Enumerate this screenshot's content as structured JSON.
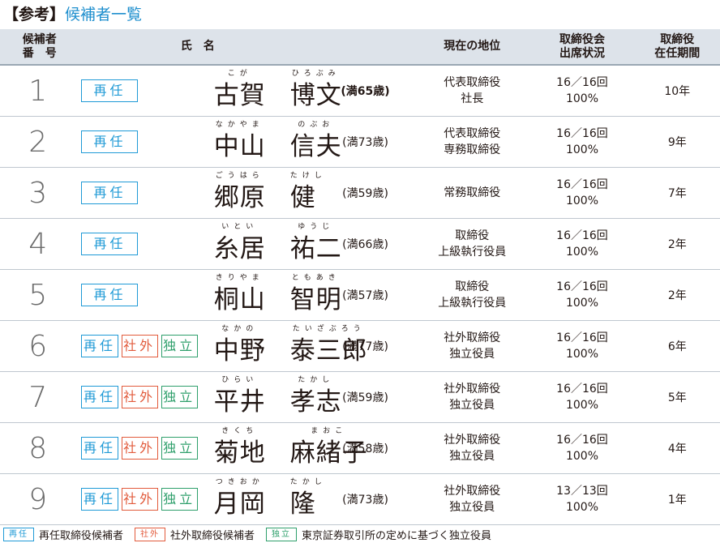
{
  "title": {
    "bracket": "【参考】",
    "text": "候補者一覧"
  },
  "headers": {
    "number": [
      "候補者",
      "番　号"
    ],
    "name": "氏　名",
    "position": "現在の地位",
    "attendance": [
      "取締役会",
      "出席状況"
    ],
    "term": [
      "取締役",
      "在任期間"
    ]
  },
  "badge_labels": {
    "re": "再任",
    "sha": "社外",
    "dok": "独立"
  },
  "colors": {
    "re": "#1f9ad6",
    "sha": "#e25b3c",
    "dok": "#2e9f6b",
    "title": "#1f8fce",
    "header_bg": "#dde3ea"
  },
  "candidates": [
    {
      "num": "1",
      "family": "古賀",
      "given": "博文",
      "family_ruby": "こが",
      "given_ruby": "ひろぶみ",
      "age": "(満65歳)",
      "pos1": "代表取締役",
      "pos2": "社長",
      "att1": "16／16回",
      "att2": "100%",
      "term": "10年",
      "outside": false
    },
    {
      "num": "2",
      "family": "中山",
      "given": "信夫",
      "family_ruby": "なかやま",
      "given_ruby": "のぶお",
      "age": "(満73歳)",
      "pos1": "代表取締役",
      "pos2": "専務取締役",
      "att1": "16／16回",
      "att2": "100%",
      "term": "9年",
      "outside": false
    },
    {
      "num": "3",
      "family": "郷原",
      "given": "健",
      "family_ruby": "ごうはら",
      "given_ruby": "たけし",
      "age": "(満59歳)",
      "pos1": "常務取締役",
      "pos2": "",
      "att1": "16／16回",
      "att2": "100%",
      "term": "7年",
      "outside": false
    },
    {
      "num": "4",
      "family": "糸居",
      "given": "祐二",
      "family_ruby": "いとい",
      "given_ruby": "ゆうじ",
      "age": "(満66歳)",
      "pos1": "取締役",
      "pos2": "上級執行役員",
      "att1": "16／16回",
      "att2": "100%",
      "term": "2年",
      "outside": false
    },
    {
      "num": "5",
      "family": "桐山",
      "given": "智明",
      "family_ruby": "きりやま",
      "given_ruby": "ともあき",
      "age": "(満57歳)",
      "pos1": "取締役",
      "pos2": "上級執行役員",
      "att1": "16／16回",
      "att2": "100%",
      "term": "2年",
      "outside": false
    },
    {
      "num": "6",
      "family": "中野",
      "given": "泰三郎",
      "family_ruby": "なかの",
      "given_ruby": "たいざぶろう",
      "age": "(満77歳)",
      "pos1": "社外取締役",
      "pos2": "独立役員",
      "att1": "16／16回",
      "att2": "100%",
      "term": "6年",
      "outside": true
    },
    {
      "num": "7",
      "family": "平井",
      "given": "孝志",
      "family_ruby": "ひらい",
      "given_ruby": "たかし",
      "age": "(満59歳)",
      "pos1": "社外取締役",
      "pos2": "独立役員",
      "att1": "16／16回",
      "att2": "100%",
      "term": "5年",
      "outside": true
    },
    {
      "num": "8",
      "family": "菊地",
      "given": "麻緒子",
      "family_ruby": "きくち",
      "given_ruby": "まおこ",
      "age": "(満58歳)",
      "pos1": "社外取締役",
      "pos2": "独立役員",
      "att1": "16／16回",
      "att2": "100%",
      "term": "4年",
      "outside": true
    },
    {
      "num": "9",
      "family": "月岡",
      "given": "隆",
      "family_ruby": "つきおか",
      "given_ruby": "たかし",
      "age": "(満73歳)",
      "pos1": "社外取締役",
      "pos2": "独立役員",
      "att1": "13／13回",
      "att2": "100%",
      "term": "1年",
      "outside": true
    }
  ],
  "legend": [
    {
      "badge": "再任",
      "text": "再任取締役候補者",
      "kind": "re"
    },
    {
      "badge": "社外",
      "text": "社外取締役候補者",
      "kind": "sha"
    },
    {
      "badge": "独立",
      "text": "東京証券取引所の定めに基づく独立役員",
      "kind": "dok"
    }
  ]
}
